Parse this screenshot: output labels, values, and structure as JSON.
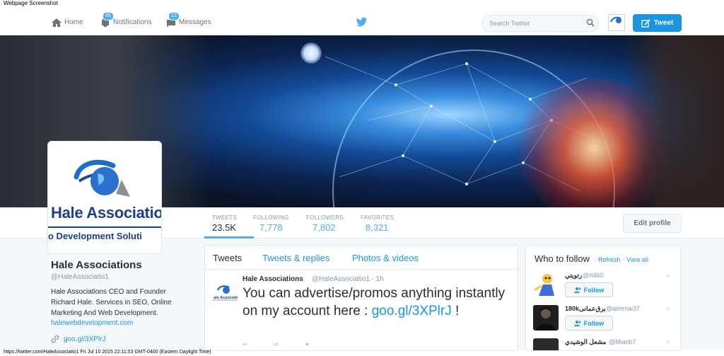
{
  "caption": {
    "top": "Webpage Screenshot",
    "bottom": "https://twitter.com/HaleAssociatio1 Fri Jul 10 2015 22:11:53 GMT-0400 (Eastern Daylight Time)"
  },
  "nav": {
    "home": "Home",
    "notifications": "Notifications",
    "notifications_badge": "45",
    "messages": "Messages",
    "messages_badge": "12",
    "search_placeholder": "Search Twitter",
    "tweet_button": "Tweet"
  },
  "profile": {
    "name": "Hale Associations",
    "handle": "@HaleAssociatio1",
    "bio": "Hale Associations CEO and Founder Richard Hale. Services in SEO, Online Marketing And Web Development.",
    "bio_link": "halewebdevelopment.com",
    "link": "goo.gl/3XPlrJ",
    "logo_text": "Hale Associatio",
    "logo_subtext": "o Development Soluti",
    "edit_button": "Edit profile"
  },
  "stats": [
    {
      "label": "TWEETS",
      "value": "23.5K"
    },
    {
      "label": "FOLLOWING",
      "value": "7,778"
    },
    {
      "label": "FOLLOWERS",
      "value": "7,802"
    },
    {
      "label": "FAVORITES",
      "value": "8,321"
    }
  ],
  "timeline": {
    "tabs": [
      "Tweets",
      "Tweets & replies",
      "Photos & videos"
    ],
    "tweet": {
      "name": "Hale Associations",
      "handle_time": "@HaleAssociatio1 · 1h",
      "text": "You can advertise/promos anything instantly on my account here :",
      "link": "goo.gl/3XPlrJ",
      "suffix": " !",
      "avatar_text": "ale Associatio"
    }
  },
  "who_to_follow": {
    "title": "Who to follow",
    "refresh": "Refresh",
    "view_all": "View all",
    "follow_label": "Follow",
    "accounts": [
      {
        "name": "رتويتي",
        "handle": "@rt460"
      },
      {
        "name": "180kبرق‌عمانی",
        "handle": "@aimmai37"
      },
      {
        "name": "مشعل الوشيدي",
        "handle": "@Miarib7"
      }
    ]
  },
  "colors": {
    "accent": "#1b95e0",
    "badge": "#55acee",
    "text": "#292f33",
    "muted": "#8899a6"
  }
}
